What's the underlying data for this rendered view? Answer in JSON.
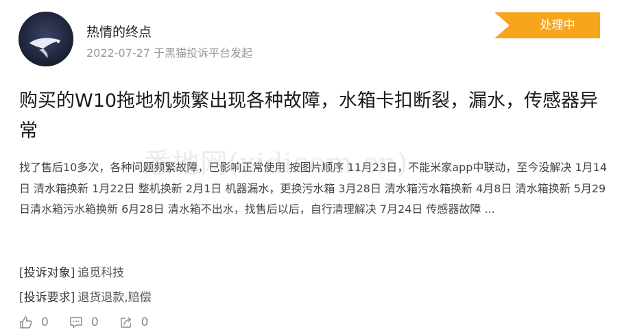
{
  "author": {
    "name": "热情的终点",
    "meta": "2022-07-27 于黑猫投诉平台发起"
  },
  "status": {
    "label": "处理中",
    "color": "#f7a51c"
  },
  "complaint": {
    "title": "购买的W10拖地机频繁出现各种故障，水箱卡扣断裂，漏水，传感器异常",
    "body": "找了售后10多次，各种问题频繁故障，已影响正常使用 按图片顺序 11月23日，不能米家app中联动，至今没解决 1月14日 清水箱换新 1月22日 整机换新 2月1日 机器漏水，更换污水箱 3月28日 清水箱污水箱换新 4月8日 清水箱换新 5月29日清水箱污水箱换新 6月28日 清水箱不出水，找售后以后，自行清理解决 7月24日 传感器故障 ..."
  },
  "info": {
    "target_label": "[投诉对象]",
    "target_value": "追觅科技",
    "request_label": "[投诉要求]",
    "request_value": "退货退款,赔偿"
  },
  "watermark": "悉地网(xidicom.cn)",
  "actions": {
    "like_count": "0",
    "comment_count": "0",
    "share_count": "0"
  }
}
